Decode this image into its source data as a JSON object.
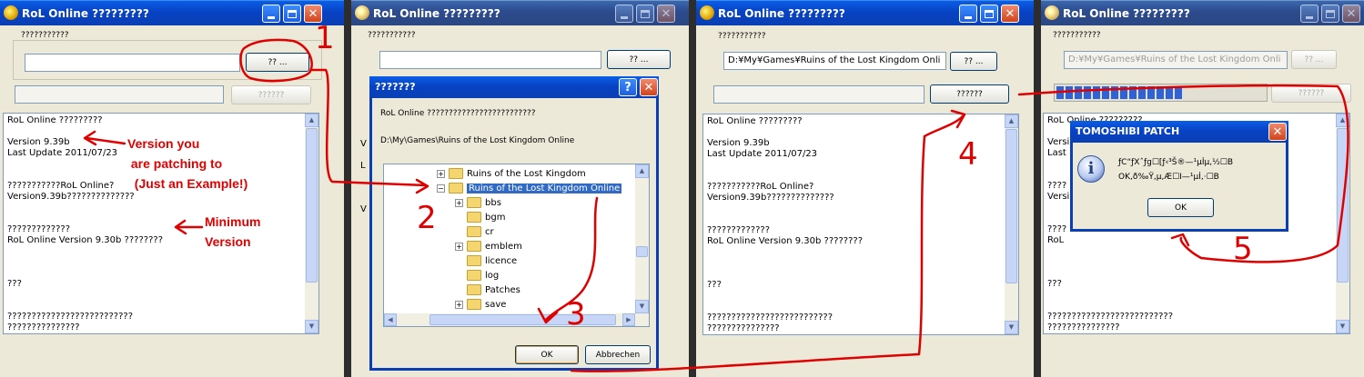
{
  "panel1": {
    "title": "RoL Online ?????????",
    "group_label": "???????????",
    "path_value": "",
    "browse_label": "?? ...",
    "start_label": "??????",
    "text_lines": [
      "RoL Online ?????????",
      "",
      "Version 9.39b",
      "Last Update 2011/07/23",
      "",
      "",
      "???????????RoL Online?",
      "Version9.39b??????????????",
      "",
      "",
      "?????????????",
      "RoL Online Version 9.30b ????????",
      "",
      "",
      "",
      "???",
      "",
      "",
      "??????????????????????????",
      "???????????????",
      "??????????????????????",
      "??????????????????????"
    ]
  },
  "panel2": {
    "title": "RoL Online ?????????",
    "group_label": "???????????",
    "browse_label": "?? ...",
    "dialog": {
      "title": "???????",
      "message": "RoL Online ?????????????????????????",
      "path": "D:\\My\\Games\\Ruins of the Lost Kingdom Online",
      "tree": [
        {
          "label": "Ruins of the Lost Kingdom",
          "expander": "+"
        },
        {
          "label": "Ruins of the Lost Kingdom Online",
          "expander": "−"
        },
        {
          "label": "bbs",
          "expander": "+"
        },
        {
          "label": "bgm",
          "expander": ""
        },
        {
          "label": "cr",
          "expander": ""
        },
        {
          "label": "emblem",
          "expander": "+"
        },
        {
          "label": "licence",
          "expander": ""
        },
        {
          "label": "log",
          "expander": ""
        },
        {
          "label": "Patches",
          "expander": ""
        },
        {
          "label": "save",
          "expander": "+"
        }
      ],
      "ok_label": "OK",
      "cancel_label": "Abbrechen",
      "help_glyph": "?",
      "close_glyph": "✕"
    }
  },
  "panel3": {
    "title": "RoL Online ?????????",
    "group_label": "???????????",
    "path_value": "D:¥My¥Games¥Ruins of the Lost Kingdom Onli",
    "browse_label": "?? ...",
    "start_label": "??????",
    "text_lines": [
      "RoL Online ?????????",
      "",
      "Version 9.39b",
      "Last Update 2011/07/23",
      "",
      "",
      "???????????RoL Online?",
      "Version9.39b??????????????",
      "",
      "",
      "?????????????",
      "RoL Online Version 9.30b ????????",
      "",
      "",
      "",
      "???",
      "",
      "",
      "??????????????????????????",
      "???????????????",
      "??????????????????????",
      "??????????????????????"
    ]
  },
  "panel4": {
    "title": "RoL Online ?????????",
    "group_label": "???????????",
    "path_value": "D:¥My¥Games¥Ruins of the Lost Kingdom Onli",
    "browse_label": "?? ...",
    "start_label": "??????",
    "progress_fraction": 0.62,
    "text_lines": [
      "RoL Online ?????????",
      "",
      "Version",
      "Last",
      "",
      "",
      "????",
      "Versi",
      "",
      "",
      "????",
      "RoL",
      "",
      "",
      "",
      "???",
      "",
      "",
      "??????????????????????????",
      "???????????????",
      "??????????????????????",
      "??????????????????????"
    ],
    "popup": {
      "title": "TOMOSHIBI PATCH",
      "message_line1": "ƒC“ƒXˆƒg☐[ƒ‹³Š®—¹µİµ,½☐B",
      "message_line2": "OK,ð‰Ÿ,µ,Æ☐I—¹µİ,·☐B",
      "ok_label": "OK",
      "close_glyph": "✕",
      "icon_glyph": "i"
    }
  },
  "annotations": {
    "version_note": "Version you\n are patching to\n  (Just an Example!)",
    "minimum_note": "Minimum\nVersion",
    "steps": [
      "1",
      "2",
      "3",
      "4",
      "5"
    ],
    "color": "#e00000"
  }
}
